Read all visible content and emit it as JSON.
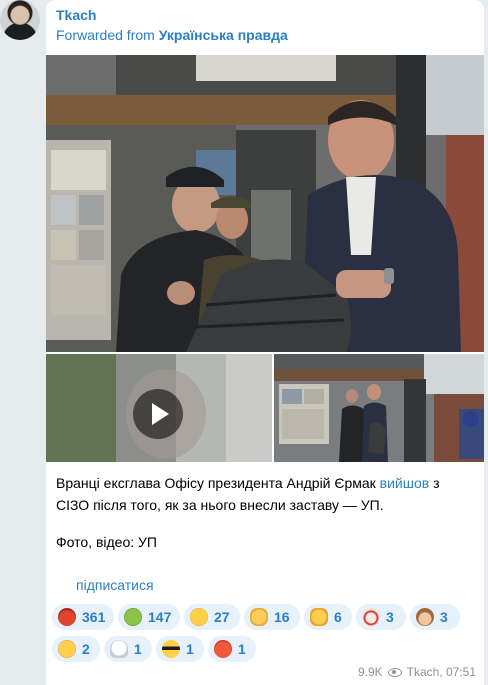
{
  "post": {
    "author": "Tkach",
    "forwarded_prefix": "Forwarded from",
    "forwarded_source": "Українська правда",
    "caption_before_link": "Вранці ексглава Офісу президента Андрій Єрмак ",
    "caption_link": "вийшов",
    "caption_after_link": " з СІЗО після того, як за нього внесли заставу — УП.",
    "credit": "Фото, відео: УП",
    "subscribe_label": "підписатися",
    "views": "9.9K",
    "signature_time": "Tkach, 07:51"
  },
  "icons": {
    "avatar": "channel-avatar",
    "play": "play-icon",
    "views": "eye-icon"
  },
  "reactions": [
    {
      "emoji": "angry-face",
      "count": "361"
    },
    {
      "emoji": "nauseated-face",
      "count": "147"
    },
    {
      "emoji": "grinning-face",
      "count": "27"
    },
    {
      "emoji": "clapping-hands",
      "count": "16"
    },
    {
      "emoji": "thumbs-up",
      "count": "6"
    },
    {
      "emoji": "clown-face",
      "count": "3"
    },
    {
      "emoji": "monkey-face",
      "count": "3"
    },
    {
      "emoji": "smiling-face-with-hearts",
      "count": "2"
    },
    {
      "emoji": "ghost",
      "count": "1"
    },
    {
      "emoji": "sunglasses-face",
      "count": "1"
    },
    {
      "emoji": "pouting-face",
      "count": "1"
    }
  ],
  "colors": {
    "accent": "#2a7fc4",
    "reaction_bg": "#e6f1fb",
    "page_bg": "#e6ebee"
  }
}
